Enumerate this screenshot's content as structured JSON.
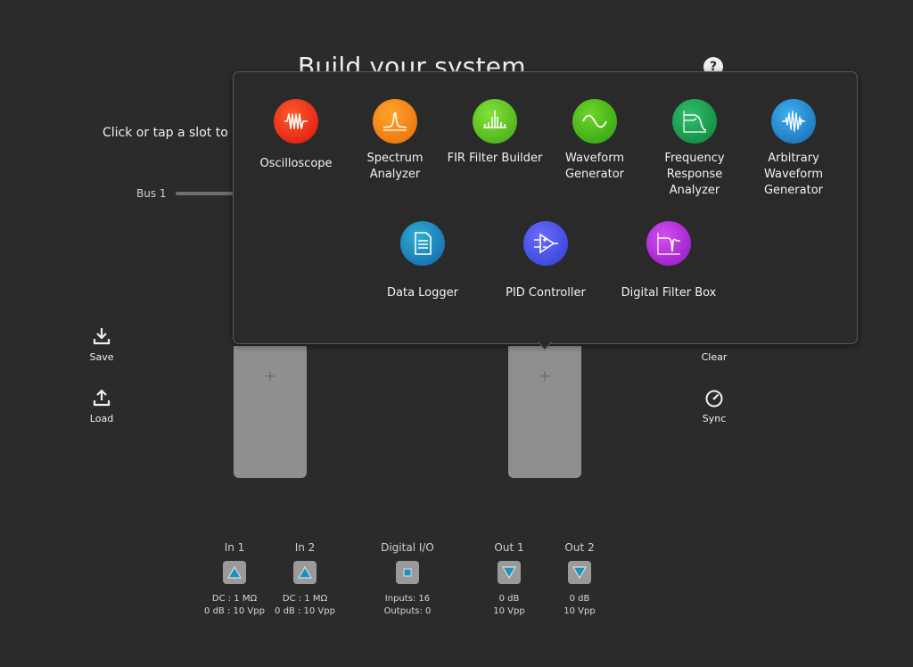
{
  "header": {
    "title": "Build your system",
    "help_icon": "?"
  },
  "instruction": "Click or tap a slot to add an instrument",
  "bus": {
    "label": "Bus 1"
  },
  "left_actions": [
    {
      "label": "Save",
      "icon": "download-icon"
    },
    {
      "label": "Load",
      "icon": "upload-icon"
    }
  ],
  "right_actions": [
    {
      "label": "Clear",
      "icon": "clear-icon"
    },
    {
      "label": "Sync",
      "icon": "gauge-icon"
    }
  ],
  "slots": [
    {
      "plus": "+"
    },
    {
      "plus": "+"
    }
  ],
  "instruments": [
    {
      "label": "Oscilloscope",
      "icon": "oscilloscope-icon",
      "color": "#e8231a"
    },
    {
      "label": "Spectrum Analyzer",
      "icon": "spectrum-analyzer-icon",
      "color": "#f07a10"
    },
    {
      "label": "FIR Filter Builder",
      "icon": "fir-filter-icon",
      "color": "#5cbf1e"
    },
    {
      "label": "Waveform Generator",
      "icon": "waveform-generator-icon",
      "color": "#3fae1c"
    },
    {
      "label": "Frequency Response Analyzer",
      "icon": "frequency-response-icon",
      "color": "#1f9e55"
    },
    {
      "label": "Arbitrary Waveform Generator",
      "icon": "arbitrary-waveform-icon",
      "color": "#1a86c8"
    },
    {
      "label": "Data Logger",
      "icon": "data-logger-icon",
      "color": "#1f8fc2"
    },
    {
      "label": "PID Controller",
      "icon": "pid-controller-icon",
      "color": "#3b5fe0"
    },
    {
      "label": "Digital Filter Box",
      "icon": "digital-filter-box-icon",
      "color": "#b02bd6"
    }
  ],
  "io": [
    {
      "name": "In 1",
      "icon": "triangle-up-icon",
      "spec1": "DC : 1 MΩ",
      "spec2": "0 dB : 10 Vpp"
    },
    {
      "name": "In 2",
      "icon": "triangle-up-icon",
      "spec1": "DC : 1 MΩ",
      "spec2": "0 dB : 10 Vpp"
    },
    {
      "name": "Digital I/O",
      "icon": "square-icon",
      "spec1": "Inputs: 16",
      "spec2": "Outputs: 0"
    },
    {
      "name": "Out 1",
      "icon": "triangle-down-icon",
      "spec1": "0 dB",
      "spec2": "10 Vpp"
    },
    {
      "name": "Out 2",
      "icon": "triangle-down-icon",
      "spec1": "0 dB",
      "spec2": "10 Vpp"
    }
  ],
  "colors": {
    "background": "#2b2b2b",
    "slot": "#8f8f8f",
    "io_accent": "#1f8fc2"
  }
}
